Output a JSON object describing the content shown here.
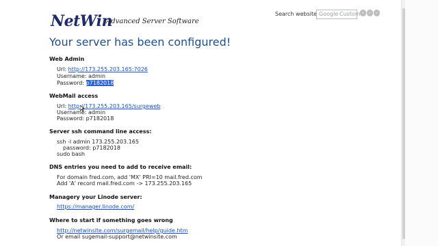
{
  "header": {
    "logo": "NetWin",
    "tagline": "Advanced Server Software",
    "search_label": "Search website:",
    "search_brand": "Google",
    "search_placeholder": "Custom"
  },
  "heading": "Your server has been configured!",
  "web_admin": {
    "title": "Web Admin",
    "url_label": "Url:",
    "url": "http://173.255.203.165:7026",
    "username_line": "Username: admin",
    "password_label": "Password:",
    "password": "p7182018"
  },
  "webmail": {
    "title": "WebMail access",
    "url_label": "Url:",
    "url": "http://173.255.203.165/surgeweb",
    "username_line": "Username: admin",
    "password_line": "Password: p7182018"
  },
  "ssh": {
    "title": "Server ssh command line access:",
    "line1": "ssh -l admin 173.255.203.165",
    "line2": "password: p7182018",
    "line3": "sudo bash"
  },
  "dns": {
    "title": "DNS entries you need to add to receive email:",
    "line1": "For domain fred.com, add 'MX' PRI=10 mail.fred.com",
    "line2": "Add 'A' record mail.fred.com -> 173.255.203.165"
  },
  "linode": {
    "title": "Managery your Linode server:",
    "link": "https://manager.linode.com/"
  },
  "start": {
    "title": "Where to start if something goes wrong",
    "link": "http://netwinsite.com/surgemail/help/guide.htm",
    "email_line": "Or email sugemail-support@netwinsite.com"
  }
}
